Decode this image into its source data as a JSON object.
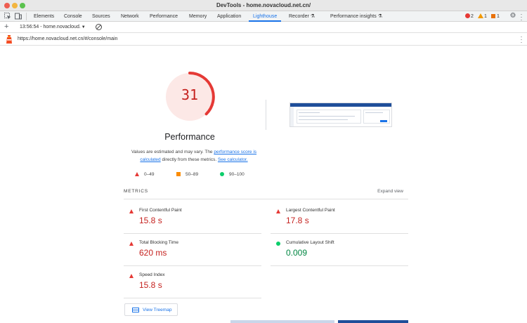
{
  "window": {
    "title": "DevTools - home.novacloud.net.cn/"
  },
  "tabs": [
    {
      "label": "Elements"
    },
    {
      "label": "Console"
    },
    {
      "label": "Sources"
    },
    {
      "label": "Network"
    },
    {
      "label": "Performance"
    },
    {
      "label": "Memory"
    },
    {
      "label": "Application"
    },
    {
      "label": "Lighthouse",
      "active": true
    },
    {
      "label": "Recorder ⚗"
    },
    {
      "label": "Performance insights ⚗"
    }
  ],
  "status": {
    "errors": "2",
    "warnings": "1",
    "issues": "1"
  },
  "toolbar": {
    "report_label": "13:56:54 - home.novacloud.",
    "add_icon": "plus-icon",
    "clear_icon": "clear-icon"
  },
  "url": {
    "text": "https://home.novacloud.net.cn/#/console/main"
  },
  "report": {
    "score": "31",
    "category": "Performance",
    "description": {
      "prefix": "Values are estimated and may vary. The ",
      "link1": "performance score is calculated",
      "middle": " directly from these metrics. ",
      "link2": "See calculator."
    },
    "legend": [
      {
        "shape": "triangle",
        "range": "0–49",
        "color": "#e53935"
      },
      {
        "shape": "square",
        "range": "50–89",
        "color": "#fb8c00"
      },
      {
        "shape": "circle",
        "range": "90–100",
        "color": "#0cce6b"
      }
    ],
    "metrics_title": "METRICS",
    "expand_label": "Expand view",
    "metrics": [
      {
        "label": "First Contentful Paint",
        "value": "15.8 s",
        "status": "fail"
      },
      {
        "label": "Largest Contentful Paint",
        "value": "17.8 s",
        "status": "fail"
      },
      {
        "label": "Total Blocking Time",
        "value": "620 ms",
        "status": "fail"
      },
      {
        "label": "Cumulative Layout Shift",
        "value": "0.009",
        "status": "pass"
      },
      {
        "label": "Speed Index",
        "value": "15.8 s",
        "status": "fail"
      }
    ],
    "treemap_label": "View Treemap"
  },
  "colors": {
    "accent": "#1a73e8",
    "fail": "#c5221f",
    "pass": "#018642",
    "gauge_fill": "#fce8e6",
    "gauge_arc": "#e53935"
  }
}
